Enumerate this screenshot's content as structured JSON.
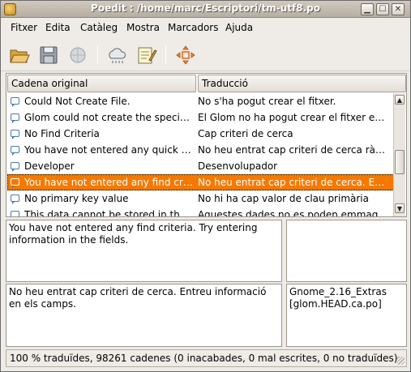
{
  "window": {
    "title": "Poedit : /home/marc/Escriptori/tm-utf8.po",
    "controls": {
      "minimize": "▁",
      "maximize": "☐",
      "close": "✕"
    }
  },
  "menu": {
    "items": [
      {
        "label": "Fitxer"
      },
      {
        "label": "Edita"
      },
      {
        "label": "Catàleg"
      },
      {
        "label": "Mostra"
      },
      {
        "label": "Marcadors"
      },
      {
        "label": "Ajuda"
      }
    ]
  },
  "toolbar": {
    "buttons": [
      {
        "icon": "open-folder-icon"
      },
      {
        "icon": "save-disk-icon"
      },
      {
        "icon": "update-globe-icon"
      },
      {
        "icon": "validate-cloud-icon"
      },
      {
        "icon": "comment-edit-icon"
      },
      {
        "icon": "fuzzy-move-icon"
      }
    ]
  },
  "list": {
    "headers": {
      "source": "Cadena original",
      "translation": "Traducció"
    },
    "rows": [
      {
        "source": "Could Not Create File.",
        "translation": "No s'ha pogut crear el fitxer."
      },
      {
        "source": "Glom could not create the specified ...",
        "translation": "El Glom no ha pogut crear el fitxer espe..."
      },
      {
        "source": "No Find Criteria",
        "translation": "Cap criteri de cerca"
      },
      {
        "source": "You have not entered any quick find ...",
        "translation": "No heu entrat cap criteri de cerca ràpida."
      },
      {
        "source": "Developer",
        "translation": "Desenvolupador"
      },
      {
        "source": "You have not entered any find criteri...",
        "translation": "No heu entrat cap criteri de cerca. Entre...",
        "selected": true
      },
      {
        "source": "No primary key value",
        "translation": "No hi ha cap valor de clau primària"
      },
      {
        "source": "This data cannot be stored in the da...",
        "translation": "Aquestes dades no es poden emmagat..."
      }
    ],
    "selected_color": "#f57900"
  },
  "panes": {
    "source_text": "You have not entered any find criteria. Try entering information in the fields.",
    "comment_text": "",
    "translation_text": "No heu entrat cap criteri de cerca. Entreu informació en els camps.",
    "reference_text": "Gnome_2.16_Extras [glom.HEAD.ca.po]"
  },
  "status": {
    "text": "100 % traduïdes, 98261 cadenes (0 inacabades, 0 mal escrites, 0 no traduïdes)"
  }
}
